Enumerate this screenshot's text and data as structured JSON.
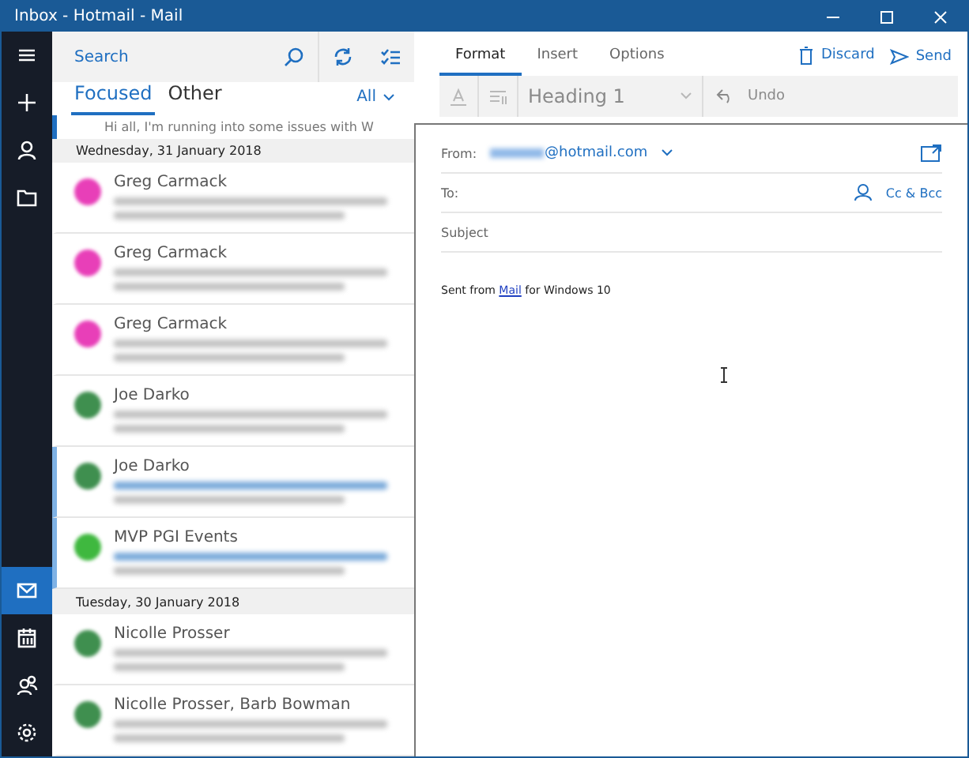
{
  "window": {
    "title": "Inbox - Hotmail - Mail"
  },
  "search": {
    "placeholder": "Search"
  },
  "list_tabs": [
    {
      "label": "Focused",
      "selected": true
    },
    {
      "label": "Other",
      "selected": false
    }
  ],
  "filter": {
    "label": "All"
  },
  "top_preview": "Hi all,   I'm running into some issues with W",
  "groups": [
    {
      "date": "Wednesday, 31 January 2018",
      "messages": [
        {
          "sender": "Greg Carmack",
          "color": "#e83fb8",
          "unread": false
        },
        {
          "sender": "Greg Carmack",
          "color": "#e83fb8",
          "unread": false
        },
        {
          "sender": "Greg Carmack",
          "color": "#e83fb8",
          "unread": false
        },
        {
          "sender": "Joe Darko",
          "color": "#3f8f4f",
          "unread": false
        },
        {
          "sender": "Joe Darko",
          "color": "#3f8f4f",
          "unread": true
        },
        {
          "sender": "MVP PGI Events",
          "color": "#3fb83f",
          "unread": true
        }
      ]
    },
    {
      "date": "Tuesday, 30 January 2018",
      "messages": [
        {
          "sender": "Nicolle Prosser",
          "color": "#3f8f4f",
          "unread": false
        },
        {
          "sender": "Nicolle Prosser, Barb Bowman",
          "color": "#3f8f4f",
          "unread": false
        }
      ]
    }
  ],
  "rail": [
    {
      "kind": "mail",
      "selected": true
    },
    {
      "kind": "calendar",
      "selected": false
    },
    {
      "kind": "people",
      "selected": false
    },
    {
      "kind": "settings",
      "selected": false
    }
  ],
  "compose_tabs": [
    {
      "label": "Format",
      "selected": true
    },
    {
      "label": "Insert",
      "selected": false
    },
    {
      "label": "Options",
      "selected": false
    }
  ],
  "actions": {
    "discard": "Discard",
    "send": "Send"
  },
  "toolbar": {
    "style": "Heading 1",
    "undo": "Undo",
    "disabled": true
  },
  "from": {
    "label": "From:",
    "address": "@hotmail.com"
  },
  "to": {
    "label": "To:",
    "cc": "Cc & Bcc"
  },
  "subject": {
    "placeholder": "Subject"
  },
  "body": {
    "before": "Sent from ",
    "link": "Mail",
    "after": " for Windows 10"
  }
}
